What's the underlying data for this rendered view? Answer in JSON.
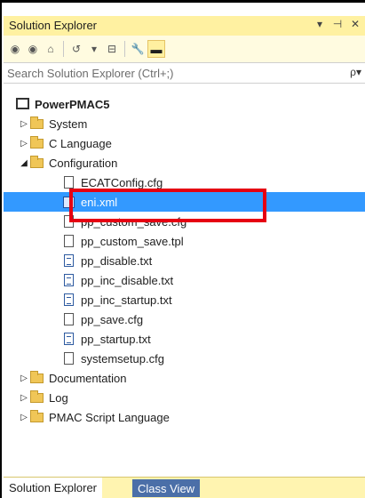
{
  "window": {
    "title": "Solution Explorer",
    "title_icons": [
      "▾",
      "⊣",
      "✕"
    ]
  },
  "toolbar": {
    "buttons": [
      "back-icon",
      "forward-icon",
      "home-icon",
      "history-icon",
      "collapse-icon",
      "properties-icon",
      "pin-icon"
    ]
  },
  "search": {
    "placeholder": "Search Solution Explorer (Ctrl+;)",
    "icon": "ρ▾"
  },
  "tree": {
    "root": "PowerPMAC5",
    "nodes": [
      {
        "label": "System",
        "type": "folder",
        "expanded": false
      },
      {
        "label": "C Language",
        "type": "folder",
        "expanded": false
      },
      {
        "label": "Configuration",
        "type": "folder",
        "expanded": true
      },
      {
        "label": "ECATConfig.cfg",
        "type": "file"
      },
      {
        "label": "eni.xml",
        "type": "xml",
        "selected": true
      },
      {
        "label": "pp_custom_save.cfg",
        "type": "file"
      },
      {
        "label": "pp_custom_save.tpl",
        "type": "file"
      },
      {
        "label": "pp_disable.txt",
        "type": "txt"
      },
      {
        "label": "pp_inc_disable.txt",
        "type": "txt"
      },
      {
        "label": "pp_inc_startup.txt",
        "type": "txt"
      },
      {
        "label": "pp_save.cfg",
        "type": "file"
      },
      {
        "label": "pp_startup.txt",
        "type": "txt"
      },
      {
        "label": "systemsetup.cfg",
        "type": "file"
      },
      {
        "label": "Documentation",
        "type": "folder",
        "expanded": false
      },
      {
        "label": "Log",
        "type": "folder",
        "expanded": false
      },
      {
        "label": "PMAC Script Language",
        "type": "folder",
        "expanded": false
      }
    ]
  },
  "tabs": {
    "active": "Solution Explorer",
    "inactive": "Class View"
  },
  "colors": {
    "selection": "#3399ff",
    "highlight_box": "#e60012",
    "title_bar": "#fff1a1"
  }
}
